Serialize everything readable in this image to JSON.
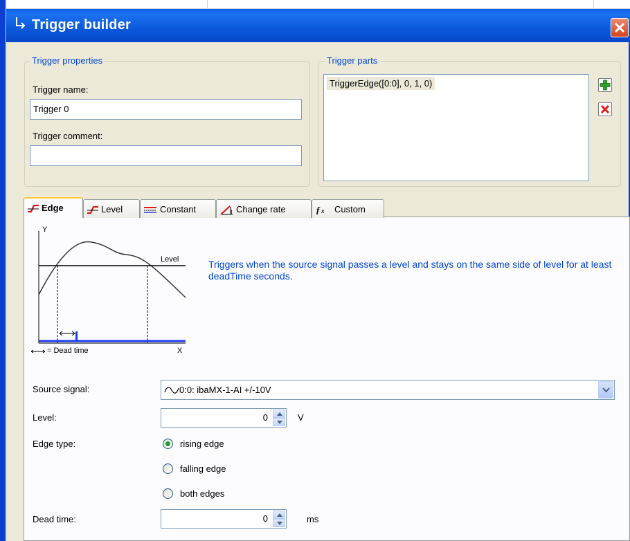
{
  "window": {
    "title": "Trigger builder",
    "title_icon": "arrow-return-icon",
    "close_icon": "close-icon"
  },
  "trigger_properties": {
    "group_title": "Trigger properties",
    "name_label": "Trigger name:",
    "name_value": "Trigger 0",
    "comment_label": "Trigger comment:",
    "comment_value": ""
  },
  "trigger_parts": {
    "group_title": "Trigger parts",
    "items": [
      "TriggerEdge([0:0], 0, 1, 0)"
    ],
    "add_icon": "plus-icon",
    "remove_icon": "delete-icon"
  },
  "tabs": [
    {
      "label": "Edge",
      "icon": "edge-icon",
      "active": true
    },
    {
      "label": "Level",
      "icon": "level-icon",
      "active": false
    },
    {
      "label": "Constant",
      "icon": "constant-icon",
      "active": false
    },
    {
      "label": "Change rate",
      "icon": "change-rate-icon",
      "active": false
    },
    {
      "label": "Custom",
      "icon": "function-icon",
      "active": false
    }
  ],
  "diagram": {
    "y_label": "Y",
    "x_label": "X",
    "level_label": "Level",
    "legend": "= Dead time"
  },
  "description": "Triggers when the source signal passes a level and stays on the same side of level for at least deadTime seconds.",
  "form": {
    "source_signal_label": "Source signal:",
    "source_signal_value": "0:0: ibaMX-1-AI +/-10V",
    "level_label": "Level:",
    "level_value": "0",
    "level_unit": "V",
    "edge_type_label": "Edge type:",
    "edge_options": [
      {
        "label": "rising edge",
        "selected": true
      },
      {
        "label": "falling edge",
        "selected": false
      },
      {
        "label": "both edges",
        "selected": false
      }
    ],
    "dead_time_label": "Dead time:",
    "dead_time_value": "0",
    "dead_time_unit": "ms"
  },
  "colors": {
    "title_bar": "#0a58dc",
    "group_title": "#0046d5",
    "dialog_bg": "#ece9d8",
    "radio_selected": "#21a121"
  }
}
